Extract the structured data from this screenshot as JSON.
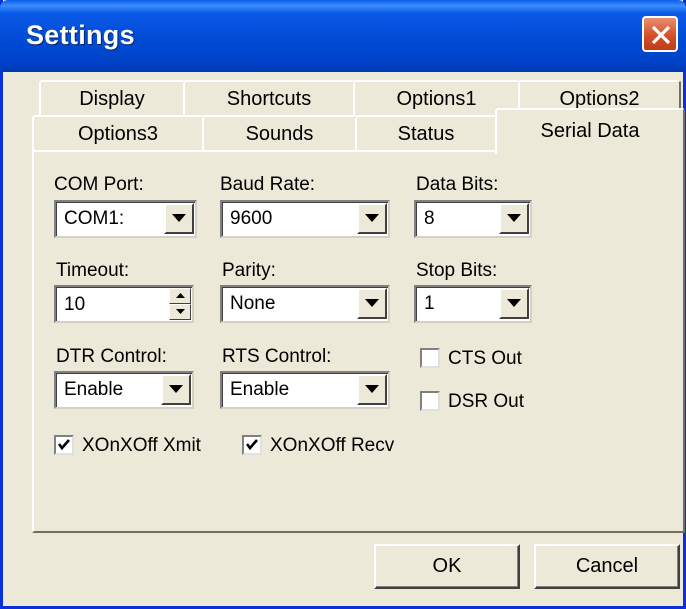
{
  "window": {
    "title": "Settings",
    "accent": "#0049d3",
    "close_color": "#d4502c",
    "icon": "close-icon"
  },
  "tabs": {
    "row1": [
      "Display",
      "Shortcuts",
      "Options1",
      "Options2"
    ],
    "row2": [
      "Options3",
      "Sounds",
      "Status",
      "Serial Data"
    ],
    "active": "Serial Data"
  },
  "serial": {
    "com_port": {
      "label": "COM Port:",
      "value": "COM1:"
    },
    "baud_rate": {
      "label": "Baud Rate:",
      "value": "9600"
    },
    "data_bits": {
      "label": "Data Bits:",
      "value": "8"
    },
    "timeout": {
      "label": "Timeout:",
      "value": "10"
    },
    "parity": {
      "label": "Parity:",
      "value": "None"
    },
    "stop_bits": {
      "label": "Stop Bits:",
      "value": "1"
    },
    "dtr_control": {
      "label": "DTR Control:",
      "value": "Enable"
    },
    "rts_control": {
      "label": "RTS Control:",
      "value": "Enable"
    },
    "cts_out": {
      "label": "CTS Out",
      "checked": false
    },
    "dsr_out": {
      "label": "DSR Out",
      "checked": false
    },
    "xon_xmit": {
      "label": "XOnXOff Xmit",
      "checked": true
    },
    "xon_recv": {
      "label": "XOnXOff Recv",
      "checked": true
    }
  },
  "buttons": {
    "ok": "OK",
    "cancel": "Cancel"
  }
}
